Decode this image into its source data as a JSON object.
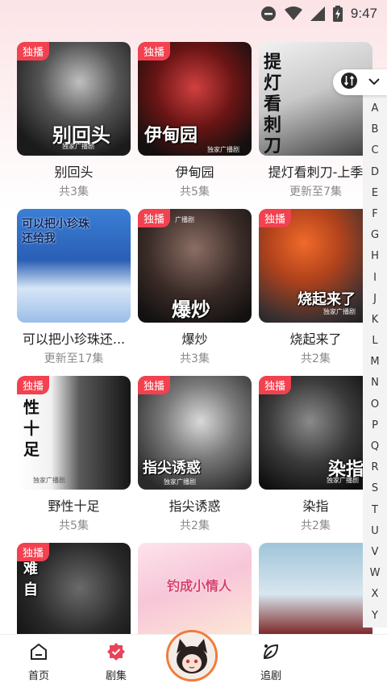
{
  "status": {
    "time": "9:47"
  },
  "badge_label": "独播",
  "cards": [
    {
      "title": "别回头",
      "meta": "共3集",
      "badge": true,
      "calli": "别回头",
      "sub": "独家广播剧"
    },
    {
      "title": "伊甸园",
      "meta": "共5集",
      "badge": true,
      "calli": "伊甸园",
      "sub": "独家广播剧"
    },
    {
      "title": "提灯看刺刀-上季",
      "meta": "更新至7集",
      "badge": false,
      "calli": "提灯看刺刀",
      "sub": ""
    },
    {
      "title": "可以把小珍珠还...",
      "meta": "更新至17集",
      "badge": false,
      "calli": "可以把小珍珠还给我",
      "sub": ""
    },
    {
      "title": "爆炒",
      "meta": "共3集",
      "badge": true,
      "calli": "爆炒",
      "sub": "广播剧"
    },
    {
      "title": "烧起来了",
      "meta": "共2集",
      "badge": true,
      "calli": "烧起来了",
      "sub": "独家广播剧"
    },
    {
      "title": "野性十足",
      "meta": "共5集",
      "badge": true,
      "calli": "性十足",
      "sub": "独家广播剧"
    },
    {
      "title": "指尖诱惑",
      "meta": "共2集",
      "badge": true,
      "calli": "指尖诱惑",
      "sub": "独家广播剧"
    },
    {
      "title": "染指",
      "meta": "共2集",
      "badge": true,
      "calli": "染指",
      "sub": "独家广播剧"
    },
    {
      "title": "",
      "meta": "",
      "badge": true,
      "calli": "难自",
      "sub": ""
    },
    {
      "title": "",
      "meta": "",
      "badge": false,
      "calli": "钓成小情人",
      "sub": ""
    },
    {
      "title": "",
      "meta": "",
      "badge": false,
      "calli": "",
      "sub": ""
    }
  ],
  "index": {
    "letters": [
      "A",
      "B",
      "C",
      "D",
      "E",
      "F",
      "G",
      "H",
      "I",
      "J",
      "K",
      "L",
      "M",
      "N",
      "O",
      "P",
      "Q",
      "R",
      "S",
      "T",
      "U",
      "V",
      "W",
      "X",
      "Y"
    ]
  },
  "nav": {
    "home": "首页",
    "series": "剧集",
    "follow": "追剧"
  },
  "colors": {
    "badge": "#f2414f",
    "avatar_ring": "#f07b3a",
    "nav_series_icon": "#e8445a"
  }
}
